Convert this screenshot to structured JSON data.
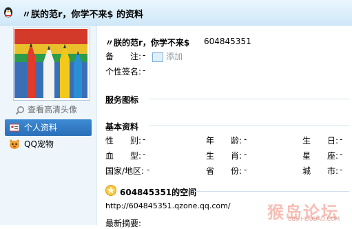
{
  "window": {
    "title": "〃朕的范r，你学不来$ 的资料"
  },
  "sidebar": {
    "view_hd_avatar": "查看高清头像",
    "items": [
      {
        "label": "个人资料",
        "icon": "profile-card-icon",
        "active": true
      },
      {
        "label": "QQ宠物",
        "icon": "qq-pet-icon",
        "active": false
      }
    ]
  },
  "profile": {
    "nickname": "〃朕的范r，你学不来$",
    "qq_number": "604845351",
    "remark_label": "备　　注:",
    "remark_value": "-",
    "add_label": "添加",
    "signature_label": "个性签名:",
    "signature_value": "-"
  },
  "services": {
    "heading": "服务图标"
  },
  "basic": {
    "heading": "基本资料",
    "rows": [
      [
        {
          "label": "性　　别:",
          "value": "-"
        },
        {
          "label": "年　　龄:",
          "value": "-"
        },
        {
          "label": "生　　日:",
          "value": "-"
        }
      ],
      [
        {
          "label": "血　　型:",
          "value": "-"
        },
        {
          "label": "生　　肖:",
          "value": "-"
        },
        {
          "label": "星　　座:",
          "value": "-"
        }
      ],
      [
        {
          "label": "国家/地区:",
          "value": "-"
        },
        {
          "label": "省　　份:",
          "value": "-"
        },
        {
          "label": "城　　市:",
          "value": "-"
        }
      ]
    ]
  },
  "space": {
    "heading": "604845351的空间",
    "url": "http://604845351.qzone.qq.com/",
    "latest_label": "最新摘要:"
  },
  "watermark": {
    "text": "猴岛论坛",
    "sub": "BBS.HOUDAO.COM"
  },
  "colors": {
    "active_nav": "#3380c8",
    "sidebar_bg": "#eef6fc",
    "title_bg": "#d6edfa"
  }
}
